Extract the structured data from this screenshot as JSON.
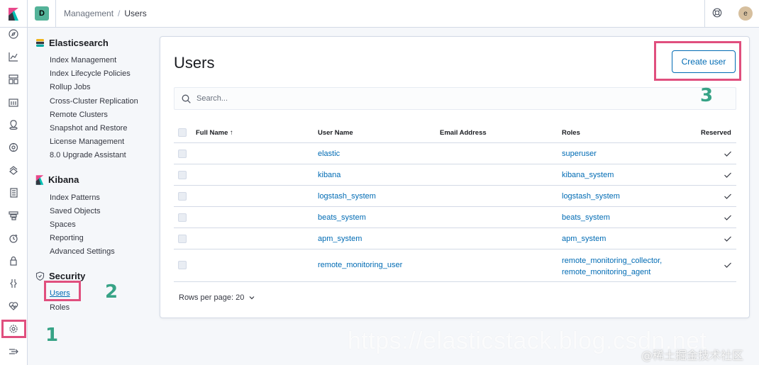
{
  "header": {
    "space_initial": "D",
    "breadcrumbs": [
      "Management",
      "Users"
    ],
    "breadcrumb_sep": "/",
    "avatar_initial": "e"
  },
  "nav_icons": [
    "compass-icon",
    "chart-icon",
    "dashboard-icon",
    "canvas-icon",
    "map-icon",
    "ml-icon",
    "infrastructure-icon",
    "logs-icon",
    "apm-icon",
    "uptime-icon",
    "siem-icon",
    "devtools-icon",
    "monitoring-icon",
    "management-icon",
    "collapse-icon"
  ],
  "sidebar": {
    "elasticsearch": {
      "title": "Elasticsearch",
      "items": [
        "Index Management",
        "Index Lifecycle Policies",
        "Rollup Jobs",
        "Cross-Cluster Replication",
        "Remote Clusters",
        "Snapshot and Restore",
        "License Management",
        "8.0 Upgrade Assistant"
      ]
    },
    "kibana": {
      "title": "Kibana",
      "items": [
        "Index Patterns",
        "Saved Objects",
        "Spaces",
        "Reporting",
        "Advanced Settings"
      ]
    },
    "security": {
      "title": "Security",
      "items": [
        "Users",
        "Roles"
      ]
    }
  },
  "main": {
    "title": "Users",
    "create_button": "Create user",
    "search_placeholder": "Search...",
    "columns": {
      "full_name": "Full Name",
      "sort_indicator": "↑",
      "user_name": "User Name",
      "email": "Email Address",
      "roles": "Roles",
      "reserved": "Reserved"
    },
    "rows": [
      {
        "user": "elastic",
        "roles": [
          "superuser"
        ]
      },
      {
        "user": "kibana",
        "roles": [
          "kibana_system"
        ]
      },
      {
        "user": "logstash_system",
        "roles": [
          "logstash_system"
        ]
      },
      {
        "user": "beats_system",
        "roles": [
          "beats_system"
        ]
      },
      {
        "user": "apm_system",
        "roles": [
          "apm_system"
        ]
      },
      {
        "user": "remote_monitoring_user",
        "roles": [
          "remote_monitoring_collector,",
          "remote_monitoring_agent"
        ]
      }
    ],
    "rows_per_page": "Rows per page: 20"
  },
  "annotations": {
    "step1": "1",
    "step2": "2",
    "step3": "3",
    "colors": {
      "highlight": "#e04f7e",
      "step_text": "#37a386"
    }
  },
  "watermark": {
    "url": "https://elasticstack.blog.csdn.net",
    "site": "@稀土掘金技术社区"
  }
}
